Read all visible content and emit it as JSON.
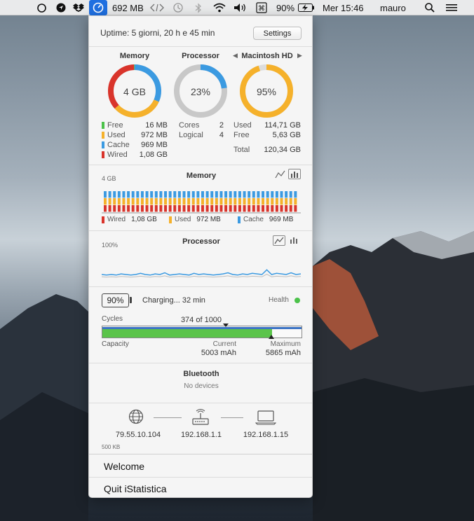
{
  "menubar": {
    "mem_value": "692 MB",
    "battery_percent": "90%",
    "datetime": "Mer 15:46",
    "user": "mauro",
    "icons": [
      "circle-icon",
      "location-icon",
      "dropbox-icon",
      "istatistica-icon",
      "code-arrows-icon",
      "time-machine-icon",
      "bluetooth-icon",
      "wifi-icon",
      "volume-icon",
      "command-icon",
      "battery-charging-icon",
      "search-icon",
      "list-icon"
    ]
  },
  "uptime": {
    "label": "Uptime: 5 giorni, 20 h e 45 min",
    "settings": "Settings"
  },
  "gauges": {
    "memory": {
      "title": "Memory",
      "center": "4 GB",
      "legend": [
        {
          "label": "Free",
          "value": "16 MB",
          "color": "#4cc24a"
        },
        {
          "label": "Used",
          "value": "972 MB",
          "color": "#f5b12b"
        },
        {
          "label": "Cache",
          "value": "969 MB",
          "color": "#3b9ae1"
        },
        {
          "label": "Wired",
          "value": "1,08 GB",
          "color": "#d9342b"
        }
      ]
    },
    "processor": {
      "title": "Processor",
      "center": "23%",
      "fraction": 0.23,
      "rows": [
        {
          "label": "Cores",
          "value": "2"
        },
        {
          "label": "Logical",
          "value": "4"
        }
      ]
    },
    "disk": {
      "title": "Macintosh HD",
      "center": "95%",
      "fraction": 0.95,
      "rows": [
        {
          "label": "Used",
          "value": "114,71 GB"
        },
        {
          "label": "Free",
          "value": "5,63 GB"
        },
        {
          "label": "Total",
          "value": "120,34 GB"
        }
      ]
    }
  },
  "memory_chart": {
    "title": "Memory",
    "ymax_label": "4 GB",
    "legend": [
      {
        "label": "Wired",
        "value": "1,08 GB",
        "color": "#d9342b"
      },
      {
        "label": "Used",
        "value": "972 MB",
        "color": "#f5b12b"
      },
      {
        "label": "Cache",
        "value": "969 MB",
        "color": "#3b9ae1"
      }
    ],
    "bar_count": 42
  },
  "processor_chart": {
    "title": "Processor",
    "ymax_label": "100%",
    "values": [
      6,
      5,
      6,
      5,
      7,
      6,
      5,
      6,
      8,
      6,
      5,
      7,
      6,
      9,
      5,
      6,
      7,
      6,
      5,
      8,
      6,
      7,
      6,
      5,
      6,
      7,
      9,
      6,
      5,
      7,
      6,
      8,
      7,
      6,
      14,
      6,
      8,
      7,
      6,
      9,
      6,
      7
    ]
  },
  "battery": {
    "percent": "90%",
    "status": "Charging... 32 min",
    "health_label": "Health",
    "health_color": "#4cc24a",
    "cycles_label": "Cycles",
    "cycles_value": "374 of 1000",
    "cycles_fraction": 0.374,
    "capacity_label": "Capacity",
    "current_label": "Current",
    "current_value": "5003 mAh",
    "maximum_label": "Maximum",
    "maximum_value": "5865 mAh",
    "capacity_fraction": 0.853
  },
  "bluetooth": {
    "title": "Bluetooth",
    "status": "No devices"
  },
  "network": {
    "public_ip": "79.55.10.104",
    "router_ip": "192.168.1.1",
    "local_ip": "192.168.1.15",
    "scale_label": "500 KB"
  },
  "menu": {
    "welcome": "Welcome",
    "quit": "Quit iStatistica"
  }
}
